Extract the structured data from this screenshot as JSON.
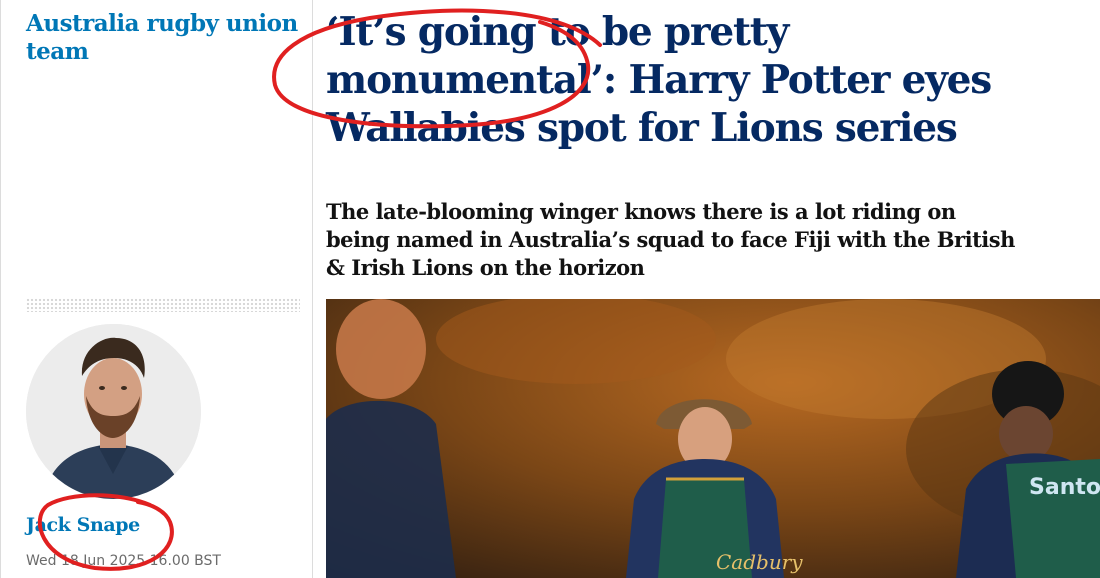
{
  "section": {
    "label": "Australia rugby union team"
  },
  "article": {
    "headline": "‘It’s going to be pretty monumental’: Harry Potter eyes Wallabies spot for Lions series",
    "standfirst": "The late-blooming winger knows there is a lot riding on being named in Australia’s squad to face Fiji with the British & Irish Lions on the horizon",
    "byline": {
      "name": "Jack Snape",
      "date": "Wed 18 Jun 2025 16.00 BST"
    },
    "photo": {
      "bib_text": "Santo",
      "chest_text": "Cadbury"
    }
  },
  "colors": {
    "section": "#0077b6",
    "headline": "#052962",
    "annotation": "#e02020"
  },
  "icons": [
    "author-avatar",
    "rugby-training-photo"
  ]
}
